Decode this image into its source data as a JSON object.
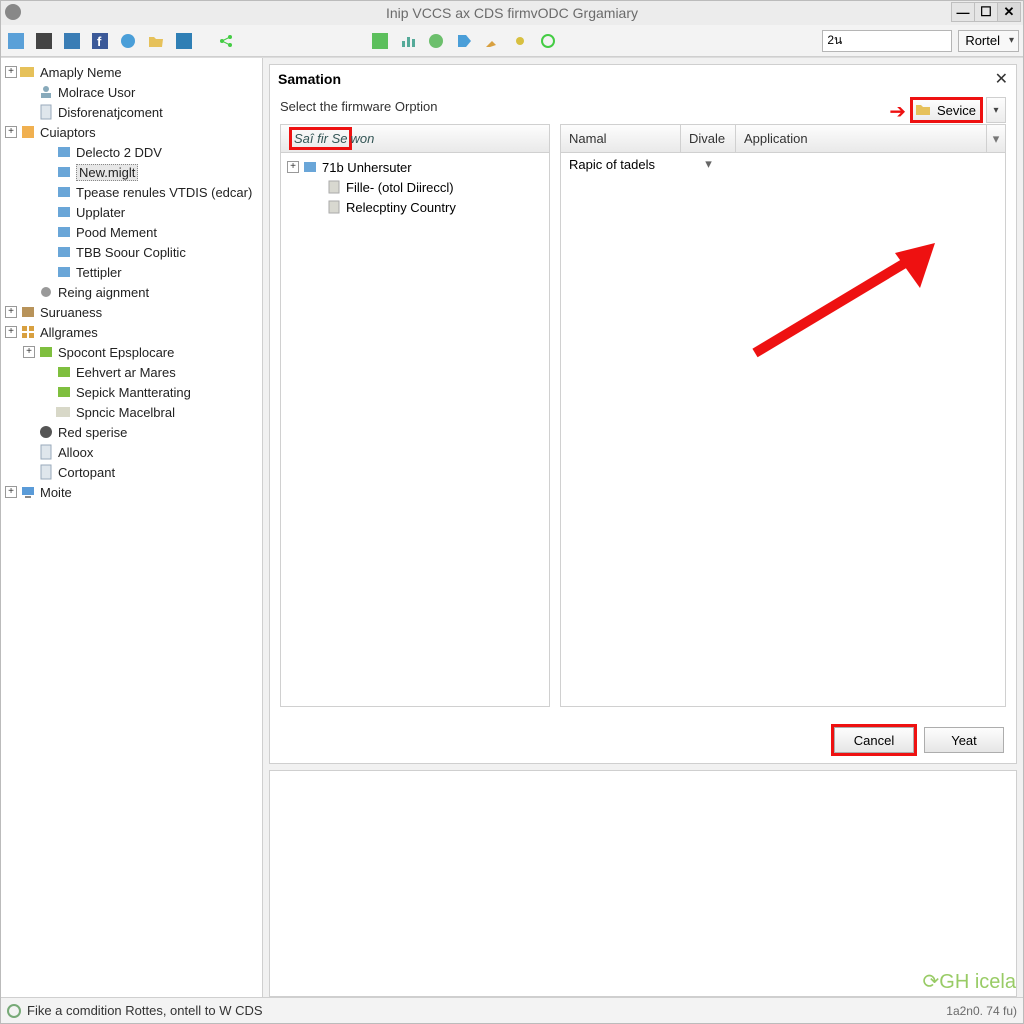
{
  "title": "Inip VCCS ax CDS firmvODC Grgamiary",
  "toolbar": {
    "search_value": "2น",
    "select_value": "Rortel"
  },
  "sidebar": [
    {
      "exp": "+",
      "icon": "folder",
      "label": "Amaply Neme",
      "depth": 0
    },
    {
      "exp": "",
      "icon": "user",
      "label": "Molrace Usor",
      "depth": 1
    },
    {
      "exp": "",
      "icon": "doc",
      "label": "Disforenatjcoment",
      "depth": 1
    },
    {
      "exp": "+",
      "icon": "chip",
      "label": "Cuiaptors",
      "depth": 0
    },
    {
      "exp": "",
      "icon": "mod",
      "label": "Delecto 2 DDV",
      "depth": 2
    },
    {
      "exp": "",
      "icon": "mod",
      "label": "New.miglt",
      "depth": 2,
      "selected": true
    },
    {
      "exp": "",
      "icon": "mod",
      "label": "Tpease renules VTDIS (edcar)",
      "depth": 2
    },
    {
      "exp": "",
      "icon": "mod",
      "label": "Upplater",
      "depth": 2
    },
    {
      "exp": "",
      "icon": "mod",
      "label": "Pood Mement",
      "depth": 2
    },
    {
      "exp": "",
      "icon": "mod",
      "label": "TBB Soour Coplitic",
      "depth": 2
    },
    {
      "exp": "",
      "icon": "mod",
      "label": "Tettipler",
      "depth": 2
    },
    {
      "exp": "",
      "icon": "gear",
      "label": "Reing aignment",
      "depth": 1
    },
    {
      "exp": "+",
      "icon": "box",
      "label": "Suruaness",
      "depth": 0
    },
    {
      "exp": "+",
      "icon": "grid",
      "label": "Allgrames",
      "depth": 0
    },
    {
      "exp": "+",
      "icon": "green",
      "label": "Spocont Epsplocare",
      "depth": 1
    },
    {
      "exp": "",
      "icon": "green",
      "label": "Eehvert ar Mares",
      "depth": 2
    },
    {
      "exp": "",
      "icon": "green",
      "label": "Sepick Mantterating",
      "depth": 2
    },
    {
      "exp": "",
      "icon": "fold2",
      "label": "Spncic Macelbral",
      "depth": 2
    },
    {
      "exp": "",
      "icon": "gearB",
      "label": "Red sperise",
      "depth": 1
    },
    {
      "exp": "",
      "icon": "doc",
      "label": "Alloox",
      "depth": 1
    },
    {
      "exp": "",
      "icon": "doc",
      "label": "Cortopant",
      "depth": 1
    },
    {
      "exp": "+",
      "icon": "monitor",
      "label": "Moite",
      "depth": 0
    }
  ],
  "panel": {
    "title": "Samation",
    "subtitle": "Select the firmware Orption",
    "left_head_a": "Saî fir Se",
    "left_head_b": "won",
    "left_items": [
      {
        "exp": "+",
        "icon": "mod",
        "label": "71b Unhersuter"
      },
      {
        "exp": "",
        "icon": "clip",
        "label": "Fille- (otol Diireccl)"
      },
      {
        "exp": "",
        "icon": "clip",
        "label": "Relecptiny Country"
      }
    ],
    "cols": {
      "c1": "Namal",
      "c2": "Divale",
      "c3": "Application"
    },
    "row1": {
      "c1": "Rapic of tadels",
      "c2": "▾",
      "c3": ""
    },
    "service_label": "Sevice",
    "cancel": "Cancel",
    "yeat": "Yeat"
  },
  "status": {
    "left": "Fike a comdition Rottes, ontell to W CDS",
    "right": "1a2n0. 74 fu)"
  },
  "watermark": "⟳GH icela"
}
